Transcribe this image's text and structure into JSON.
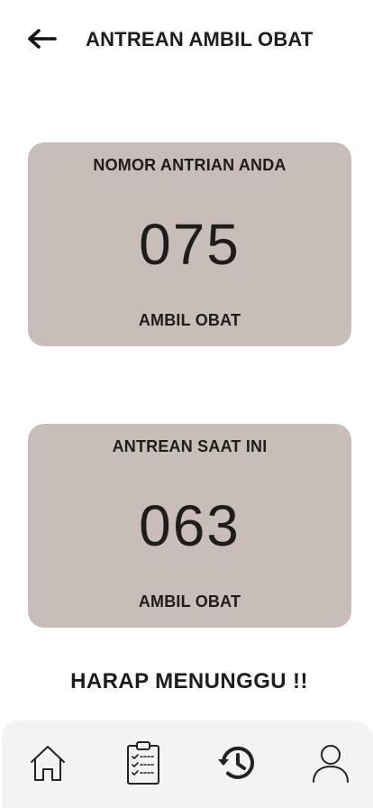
{
  "header": {
    "title": "ANTREAN AMBIL OBAT",
    "back_icon": "arrow-left-icon"
  },
  "my_queue": {
    "label": "NOMOR ANTRIAN ANDA",
    "number": "075",
    "footer": "AMBIL OBAT"
  },
  "current_queue": {
    "label": "ANTREAN SAAT INI",
    "number": "063",
    "footer": "AMBIL OBAT"
  },
  "message": "HARAP MENUNGGU !!",
  "bottom_nav": {
    "items": [
      {
        "icon": "home-icon"
      },
      {
        "icon": "clipboard-checklist-icon"
      },
      {
        "icon": "history-icon"
      },
      {
        "icon": "user-icon"
      }
    ]
  },
  "colors": {
    "card_background": "#c9bdb9",
    "text": "#1f1c1c",
    "nav_background": "#f3f3f3"
  }
}
